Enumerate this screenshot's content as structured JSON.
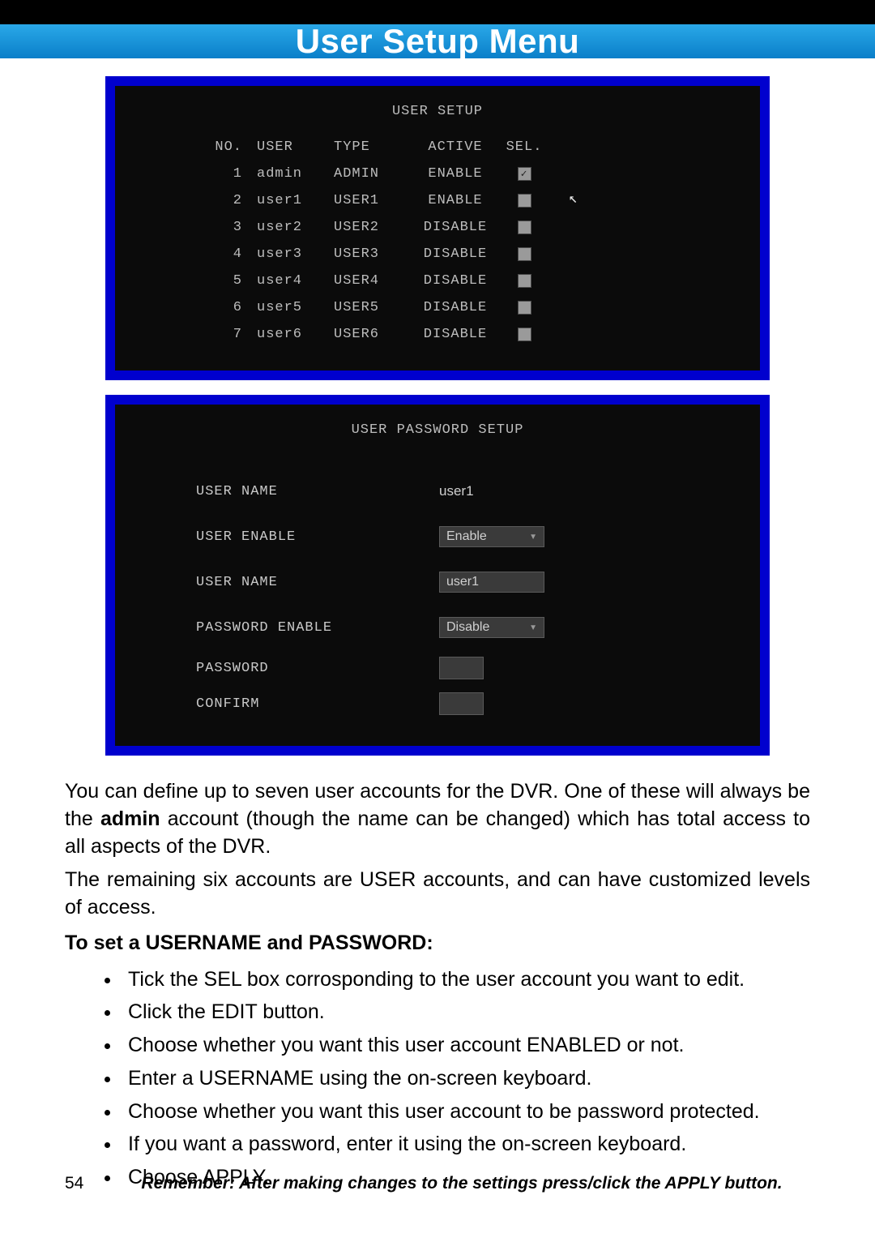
{
  "header": {
    "title": "User Setup Menu"
  },
  "panel1": {
    "title": "USER SETUP",
    "columns": {
      "no": "NO.",
      "user": "USER",
      "type": "TYPE",
      "active": "ACTIVE",
      "sel": "SEL."
    },
    "rows": [
      {
        "no": "1",
        "user": "admin",
        "type": "ADMIN",
        "active": "ENABLE",
        "sel": true
      },
      {
        "no": "2",
        "user": "user1",
        "type": "USER1",
        "active": "ENABLE",
        "sel": false
      },
      {
        "no": "3",
        "user": "user2",
        "type": "USER2",
        "active": "DISABLE",
        "sel": false
      },
      {
        "no": "4",
        "user": "user3",
        "type": "USER3",
        "active": "DISABLE",
        "sel": false
      },
      {
        "no": "5",
        "user": "user4",
        "type": "USER4",
        "active": "DISABLE",
        "sel": false
      },
      {
        "no": "6",
        "user": "user5",
        "type": "USER5",
        "active": "DISABLE",
        "sel": false
      },
      {
        "no": "7",
        "user": "user6",
        "type": "USER6",
        "active": "DISABLE",
        "sel": false
      }
    ]
  },
  "panel2": {
    "title": "USER PASSWORD SETUP",
    "labels": {
      "user_name1": "USER NAME",
      "user_enable": "USER ENABLE",
      "user_name2": "USER NAME",
      "password_enable": "PASSWORD ENABLE",
      "password": "PASSWORD",
      "confirm": "CONFIRM"
    },
    "values": {
      "user_name1": "user1",
      "user_enable": "Enable",
      "user_name2": "user1",
      "password_enable": "Disable",
      "password": "",
      "confirm": ""
    }
  },
  "body": {
    "p1a": "You can define up to seven user accounts for the DVR. One of these will always be the ",
    "p1_bold": "admin",
    "p1b": " account (though the name can be changed) which has total access to all aspects of the DVR.",
    "p2": "The remaining six accounts  are USER accounts, and can have customized levels of access.",
    "heading": "To set a USERNAME and PASSWORD:",
    "steps": [
      "Tick the SEL box corrosponding to the user account you want to edit.",
      "Click the EDIT button.",
      "Choose whether you want this user account ENABLED or not.",
      "Enter a USERNAME using the on-screen keyboard.",
      "Choose whether you want this user account to be password protected.",
      "If you want a password, enter it using the on-screen keyboard.",
      "Choose APPLY."
    ]
  },
  "footer": {
    "page": "54",
    "msg": "Remember: After making changes to the settings press/click the APPLY button."
  }
}
